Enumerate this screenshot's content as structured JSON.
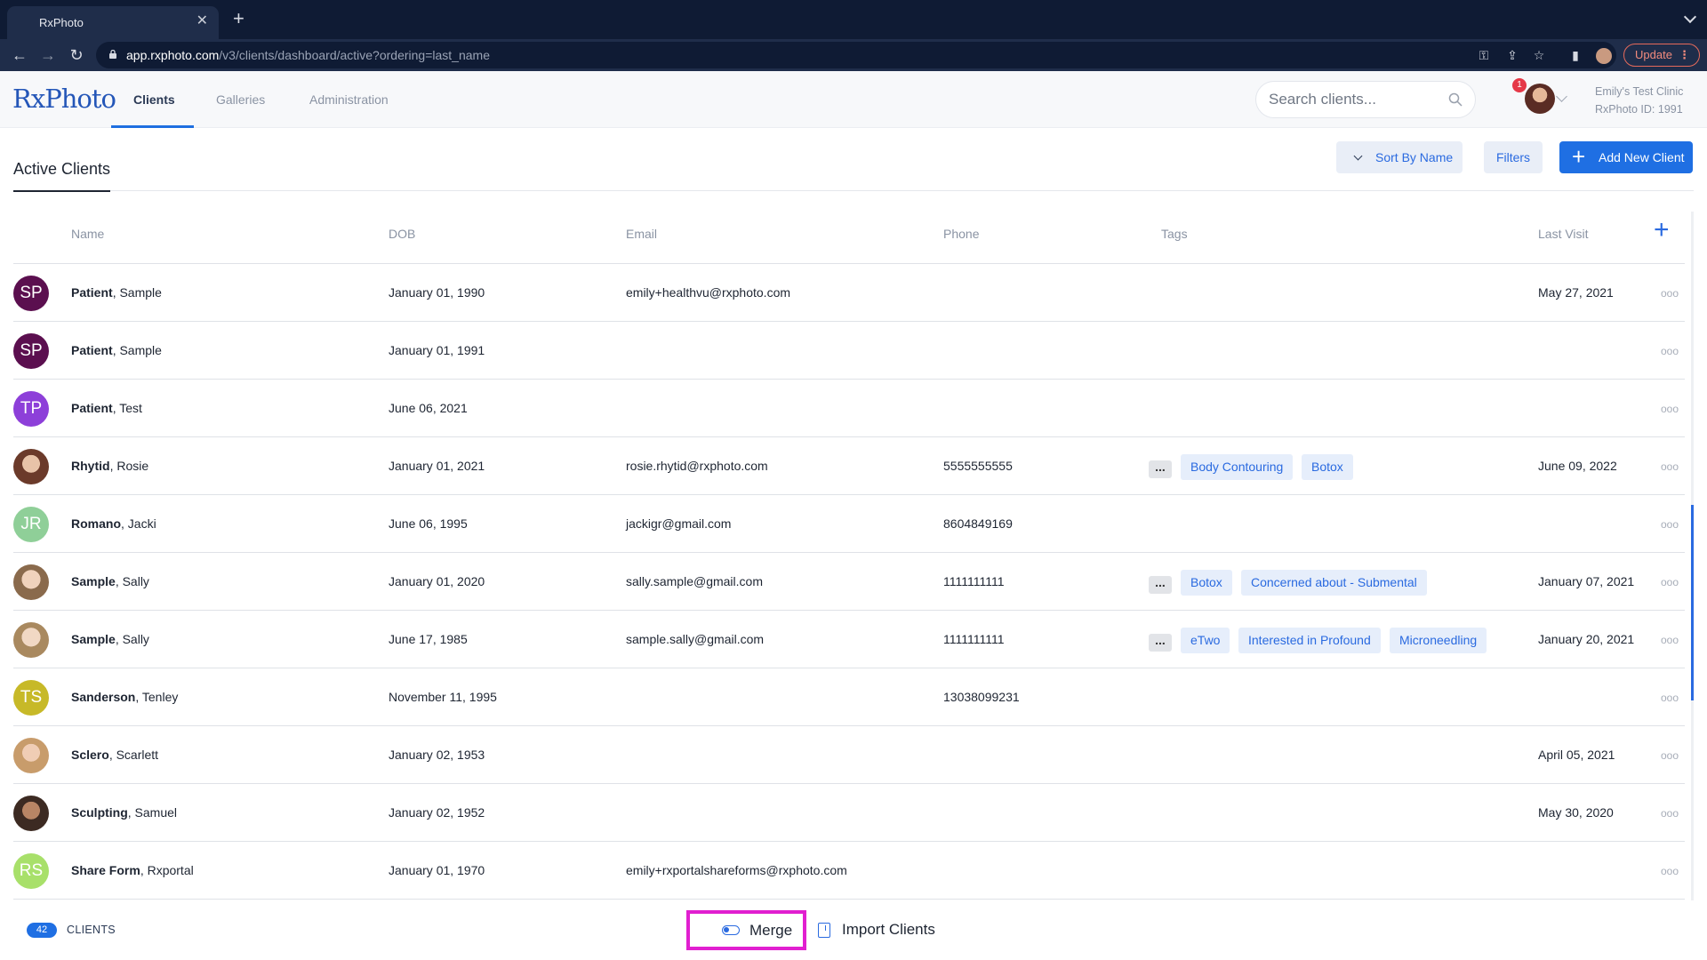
{
  "browser": {
    "tab_title": "RxPhoto",
    "url_host": "app.rxphoto.com",
    "url_path": "/v3/clients/dashboard/active?ordering=last_name",
    "update_label": "Update"
  },
  "app": {
    "logo": "RxPhoto",
    "nav": [
      "Clients",
      "Galleries",
      "Administration"
    ],
    "search_placeholder": "Search clients...",
    "notification_count": "1",
    "clinic_name": "Emily's Test Clinic",
    "clinic_id": "RxPhoto ID: 1991"
  },
  "page": {
    "title": "Active Clients",
    "sort_label": "Sort By Name",
    "filters_label": "Filters",
    "add_label": "Add New Client"
  },
  "table": {
    "columns": {
      "name": "Name",
      "dob": "DOB",
      "email": "Email",
      "phone": "Phone",
      "tags": "Tags",
      "last_visit": "Last Visit"
    },
    "more_tags": "...",
    "row_menu": "ooo",
    "rows": [
      {
        "initials": "SP",
        "avatar_color": "#5b0f4f",
        "last": "Patient",
        "first": ", Sample",
        "dob": "January 01, 1990",
        "email": "emily+healthvu@rxphoto.com",
        "phone": "",
        "tags": [],
        "last_visit": "May 27, 2021"
      },
      {
        "initials": "SP",
        "avatar_color": "#5b0f4f",
        "last": "Patient",
        "first": ", Sample",
        "dob": "January 01, 1991",
        "email": "",
        "phone": "",
        "tags": [],
        "last_visit": ""
      },
      {
        "initials": "TP",
        "avatar_color": "#8d3fd9",
        "last": "Patient",
        "first": ", Test",
        "dob": "June 06, 2021",
        "email": "",
        "phone": "",
        "tags": [],
        "last_visit": ""
      },
      {
        "photo": true,
        "last": "Rhytid",
        "first": ", Rosie",
        "dob": "January 01, 2021",
        "email": "rosie.rhytid@rxphoto.com",
        "phone": "5555555555",
        "tags": [
          "Body Contouring",
          "Botox"
        ],
        "last_visit": "June 09, 2022"
      },
      {
        "initials": "JR",
        "avatar_color": "#8fcf98",
        "last": "Romano",
        "first": ", Jacki",
        "dob": "June 06, 1995",
        "email": "jackigr@gmail.com",
        "phone": "8604849169",
        "tags": [],
        "last_visit": ""
      },
      {
        "photo": true,
        "last": "Sample",
        "first": ", Sally",
        "dob": "January 01, 2020",
        "email": "sally.sample@gmail.com",
        "phone": "1111111111",
        "tags": [
          "Botox",
          "Concerned about - Submental"
        ],
        "last_visit": "January 07, 2021"
      },
      {
        "photo": true,
        "last": "Sample",
        "first": ", Sally",
        "dob": "June 17, 1985",
        "email": "sample.sally@gmail.com",
        "phone": "1111111111",
        "tags": [
          "eTwo",
          "Interested in Profound",
          "Microneedling"
        ],
        "last_visit": "January 20, 2021"
      },
      {
        "initials": "TS",
        "avatar_color": "#c7b928",
        "last": "Sanderson",
        "first": ", Tenley",
        "dob": "November 11, 1995",
        "email": "",
        "phone": "13038099231",
        "tags": [],
        "last_visit": ""
      },
      {
        "photo": true,
        "last": "Sclero",
        "first": ", Scarlett",
        "dob": "January 02, 1953",
        "email": "",
        "phone": "",
        "tags": [],
        "last_visit": "April 05, 2021"
      },
      {
        "photo": true,
        "last": "Sculpting",
        "first": ", Samuel",
        "dob": "January 02, 1952",
        "email": "",
        "phone": "",
        "tags": [],
        "last_visit": "May 30, 2020"
      },
      {
        "initials": "RS",
        "avatar_color": "#a8e06a",
        "last": "Share Form",
        "first": ", Rxportal",
        "dob": "January 01, 1970",
        "email": "emily+rxportalshareforms@rxphoto.com",
        "phone": "",
        "tags": [],
        "last_visit": ""
      }
    ]
  },
  "footer": {
    "client_count": "42",
    "count_label": "CLIENTS",
    "merge_label": "Merge",
    "import_label": "Import Clients"
  },
  "colors": {
    "accent": "#1f6fe3",
    "merge_highlight": "#e11fd0"
  }
}
